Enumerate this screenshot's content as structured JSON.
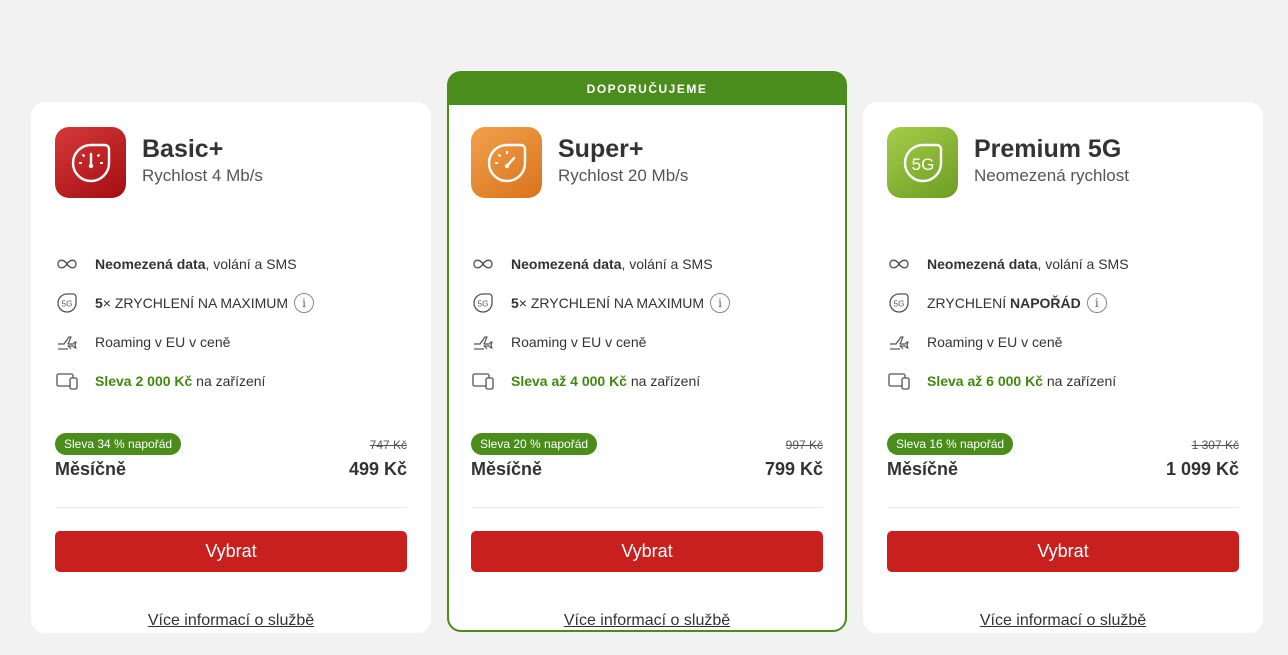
{
  "plans": [
    {
      "name": "Basic+",
      "speed": "Rychlost 4 Mb/s",
      "features": {
        "data_bold": "Neomezená data",
        "data_rest": ", volání a SMS",
        "speed_bold": "5",
        "speed_rest": "× ZRYCHLENÍ NA MAXIMUM",
        "roaming": "Roaming v EU v ceně",
        "discount_green": "Sleva 2 000 Kč",
        "discount_rest": " na zařízení"
      },
      "badge": "Sleva 34 % napořád",
      "old_price": "747 Kč",
      "monthly_label": "Měsíčně",
      "price": "499 Kč",
      "button": "Vybrat",
      "more_link": "Více informací o službě"
    },
    {
      "ribbon": "DOPORUČUJEME",
      "name": "Super+",
      "speed": "Rychlost 20 Mb/s",
      "features": {
        "data_bold": "Neomezená data",
        "data_rest": ", volání a SMS",
        "speed_bold": "5",
        "speed_rest": "× ZRYCHLENÍ NA MAXIMUM",
        "roaming": "Roaming v EU v ceně",
        "discount_green": "Sleva až 4 000 Kč",
        "discount_rest": " na zařízení"
      },
      "badge": "Sleva 20 % napořád",
      "old_price": "997 Kč",
      "monthly_label": "Měsíčně",
      "price": "799 Kč",
      "button": "Vybrat",
      "more_link": "Více informací o službě"
    },
    {
      "name": "Premium 5G",
      "speed": "Neomezená rychlost",
      "features": {
        "data_bold": "Neomezená data",
        "data_rest": ", volání a SMS",
        "speed_prefix": "ZRYCHLENÍ ",
        "speed_bold": "NAPOŘÁD",
        "roaming": "Roaming v EU v ceně",
        "discount_green": "Sleva až 6 000 Kč",
        "discount_rest": " na zařízení"
      },
      "badge": "Sleva 16 % napořád",
      "old_price": "1 307 Kč",
      "monthly_label": "Měsíčně",
      "price": "1 099 Kč",
      "button": "Vybrat",
      "more_link": "Více informací o službě",
      "logo_text": "5G"
    }
  ],
  "icons": {
    "infinity": "infinity-icon",
    "fiveg": "5g-icon",
    "plane": "plane-icon",
    "devices": "devices-icon",
    "info": "i"
  },
  "colors": {
    "accent_red": "#c8201f",
    "green": "#4a8d1c",
    "background": "#f2f2f2"
  }
}
